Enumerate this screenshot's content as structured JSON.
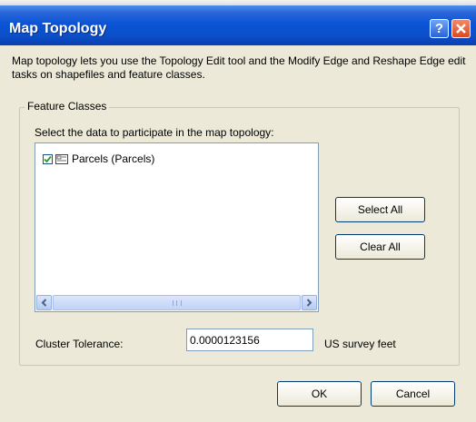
{
  "window": {
    "title": "Map Topology",
    "help_button": "?",
    "close_button": "X",
    "description": "Map topology lets you use the Topology Edit tool and the Modify Edge and Reshape Edge edit tasks on shapefiles and feature classes."
  },
  "feature_classes": {
    "legend": "Feature Classes",
    "instruction": "Select the data to participate in the map topology:",
    "items": [
      {
        "label": "Parcels (Parcels)",
        "checked": true
      }
    ],
    "select_all_label": "Select All",
    "clear_all_label": "Clear All"
  },
  "cluster": {
    "label": "Cluster Tolerance:",
    "value": "0.0000123156",
    "unit": "US survey feet"
  },
  "footer": {
    "ok_label": "OK",
    "cancel_label": "Cancel"
  },
  "colors": {
    "titlebar": "#0a54d6",
    "dialog_bg": "#ece9d8",
    "button_border": "#003c74",
    "close_button": "#d84a22"
  },
  "icons": [
    "help-icon",
    "close-icon",
    "checkbox-checked-icon",
    "feature-class-icon",
    "scroll-left-icon",
    "scroll-right-icon"
  ]
}
